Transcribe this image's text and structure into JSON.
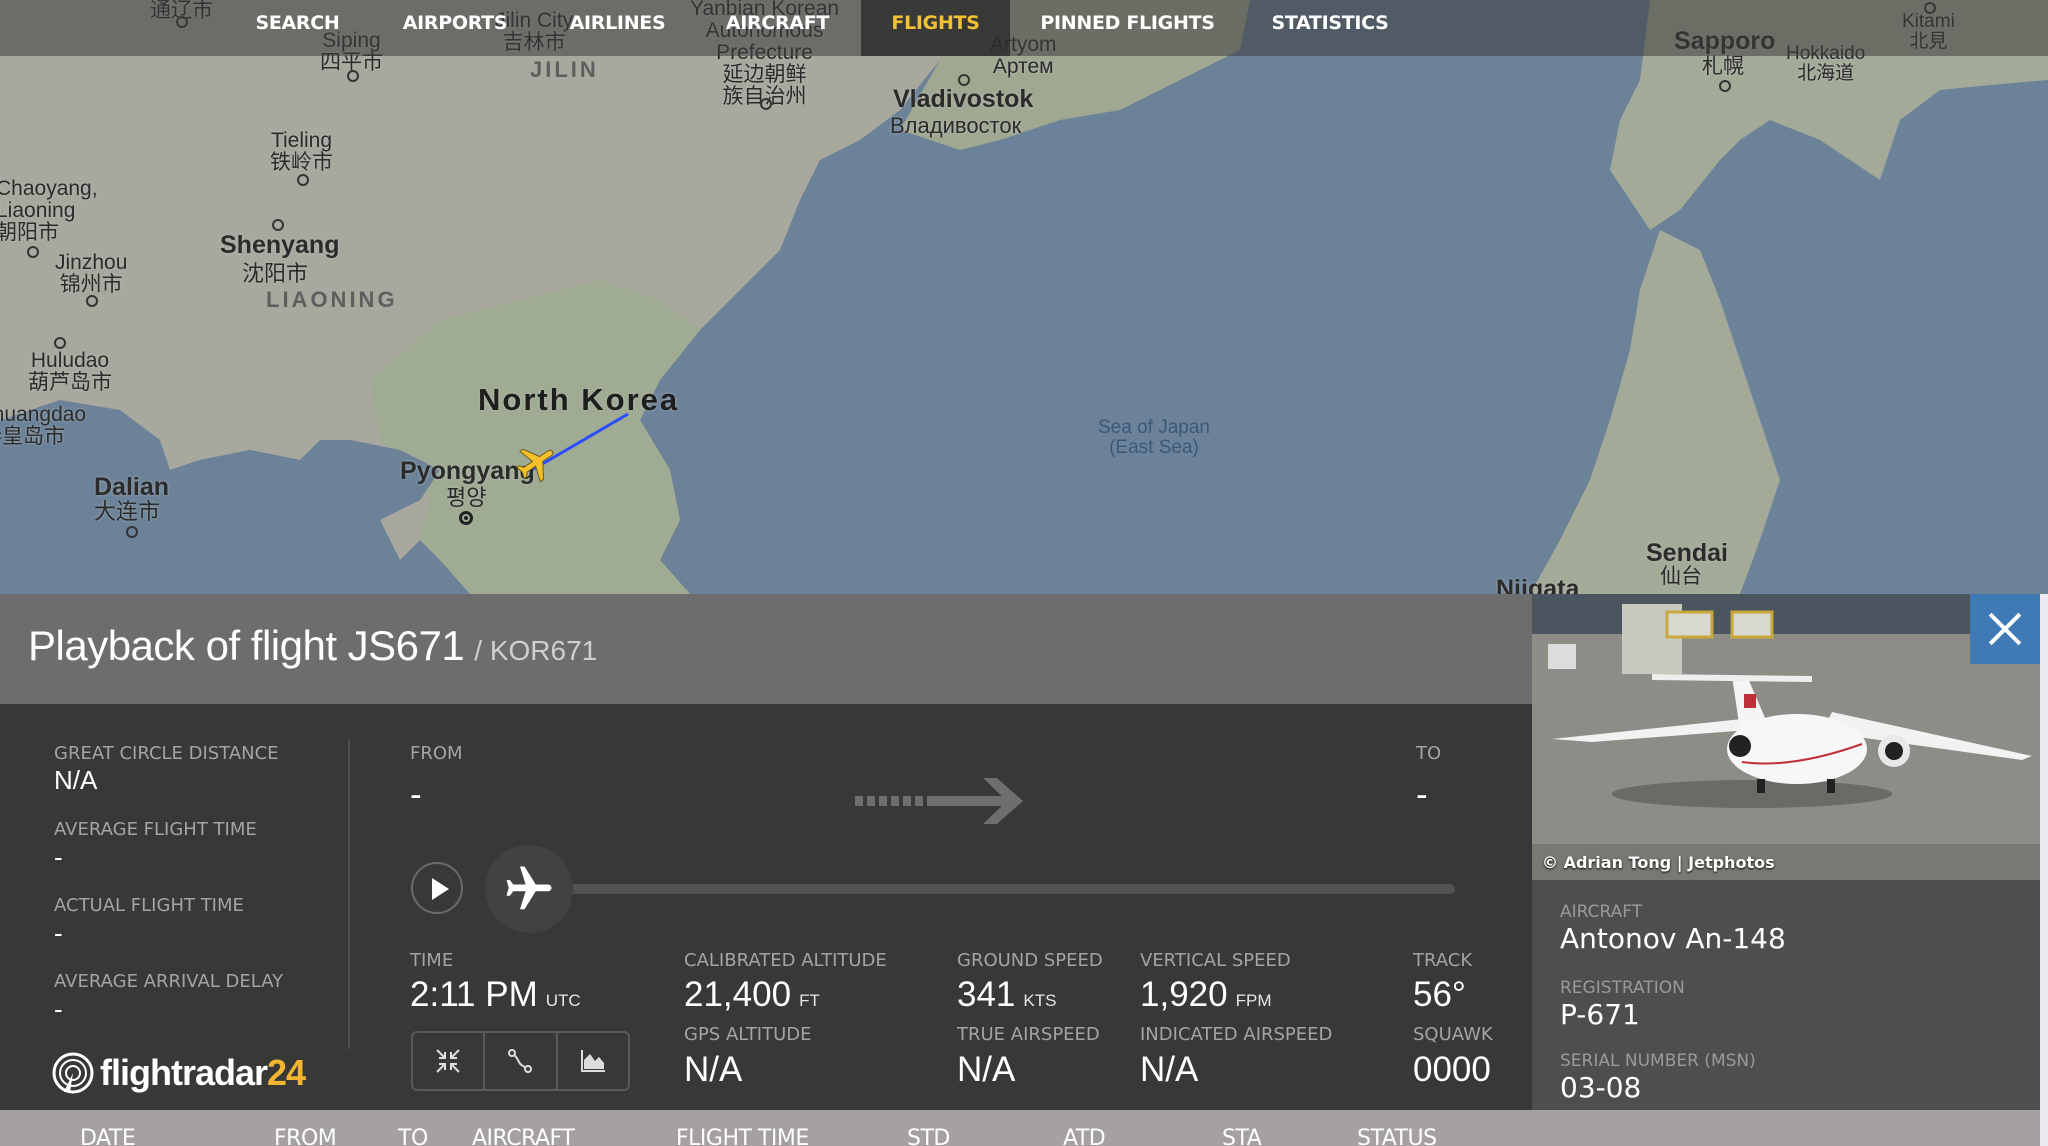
{
  "nav": {
    "items": [
      {
        "label": "SEARCH",
        "active": false
      },
      {
        "label": "AIRPORTS",
        "active": false
      },
      {
        "label": "AIRLINES",
        "active": false
      },
      {
        "label": "AIRCRAFT",
        "active": false
      },
      {
        "label": "FLIGHTS",
        "active": true
      },
      {
        "label": "PINNED FLIGHTS",
        "active": false
      },
      {
        "label": "STATISTICS",
        "active": false
      }
    ],
    "active_color": "#f2c232"
  },
  "map": {
    "labels": {
      "tongliao": "通辽市",
      "siping": "Siping\n四平市",
      "jilin_city": "Jilin City\n吉林市",
      "jilin": "JILIN",
      "yanbian": "Yanbian Korean\nAutonomous\nPrefecture\n延边朝鲜\n族自治州",
      "artyom": "Artyom\nАртем",
      "vladivostok": "Vladivostok",
      "vladivostok_ru": "Владивосток",
      "tieling": "Tieling\n铁岭市",
      "chaoyang": "Chaoyang,\nLiaoning\n朝阳市",
      "shenyang": "Shenyang",
      "shenyang_cn": "沈阳市",
      "liaoning": "LIAONING",
      "jinzhou": "Jinzhou\n锦州市",
      "huludao": "Huludao\n葫芦岛市",
      "qinhuangdao": "Qinhuangdao\n秦皇岛市",
      "dalian": "Dalian",
      "dalian_cn": "大连市",
      "north_korea": "North Korea",
      "pyongyang": "Pyongyang",
      "pyongyang_kr": "평양",
      "sea_of_japan": "Sea of Japan\n(East Sea)",
      "sapporo": "Sapporo",
      "sapporo_jp": "札幌",
      "hokkaido": "Hokkaido\n北海道",
      "kitami": "Kitami\n北見",
      "sendai": "Sendai",
      "sendai_jp": "仙台",
      "niigata": "Niigata"
    },
    "flight_path_color": "#2a4bff",
    "aircraft_icon_color": "#f5c02a",
    "aircraft_icon": "airplane-icon"
  },
  "panel": {
    "title": "Playback of flight JS671",
    "subtitle": "/ KOR671",
    "stats": {
      "great_circle_distance": {
        "label": "GREAT CIRCLE DISTANCE",
        "value": "N/A"
      },
      "average_flight_time": {
        "label": "AVERAGE FLIGHT TIME",
        "value": "-"
      },
      "actual_flight_time": {
        "label": "ACTUAL FLIGHT TIME",
        "value": "-"
      },
      "average_arrival_delay": {
        "label": "AVERAGE ARRIVAL DELAY",
        "value": "-"
      }
    },
    "route": {
      "from_label": "FROM",
      "from_value": "-",
      "to_label": "TO",
      "to_value": "-"
    },
    "playback": {
      "progress": 0,
      "play_icon": "play-icon"
    },
    "telemetry": {
      "time": {
        "label": "TIME",
        "value": "2:11 PM",
        "unit": "UTC"
      },
      "calibrated_altitude": {
        "label": "CALIBRATED ALTITUDE",
        "value": "21,400",
        "unit": "FT"
      },
      "ground_speed": {
        "label": "GROUND SPEED",
        "value": "341",
        "unit": "KTS"
      },
      "vertical_speed": {
        "label": "VERTICAL SPEED",
        "value": "1,920",
        "unit": "FPM"
      },
      "track": {
        "label": "TRACK",
        "value": "56°"
      },
      "gps_altitude": {
        "label": "GPS ALTITUDE",
        "value": "N/A"
      },
      "true_airspeed": {
        "label": "TRUE AIRSPEED",
        "value": "N/A"
      },
      "indicated_airspeed": {
        "label": "INDICATED AIRSPEED",
        "value": "N/A"
      },
      "squawk": {
        "label": "SQUAWK",
        "value": "0000"
      }
    },
    "tool_buttons": [
      "collapse-icon",
      "route-icon",
      "chart-icon"
    ],
    "logo": {
      "text": "flightradar",
      "number": "24",
      "accent_color": "#f2b630"
    }
  },
  "aircraft_card": {
    "photo_credit": "© Adrian Tong | Jetphotos",
    "aircraft": {
      "label": "AIRCRAFT",
      "value": "Antonov An-148"
    },
    "registration": {
      "label": "REGISTRATION",
      "value": "P-671"
    },
    "serial_number": {
      "label": "SERIAL NUMBER (MSN)",
      "value": "03-08"
    },
    "close_button_color": "#3f7ab5"
  },
  "table": {
    "columns": [
      "DATE",
      "FROM",
      "TO",
      "AIRCRAFT",
      "FLIGHT TIME",
      "STD",
      "ATD",
      "STA",
      "STATUS"
    ]
  }
}
